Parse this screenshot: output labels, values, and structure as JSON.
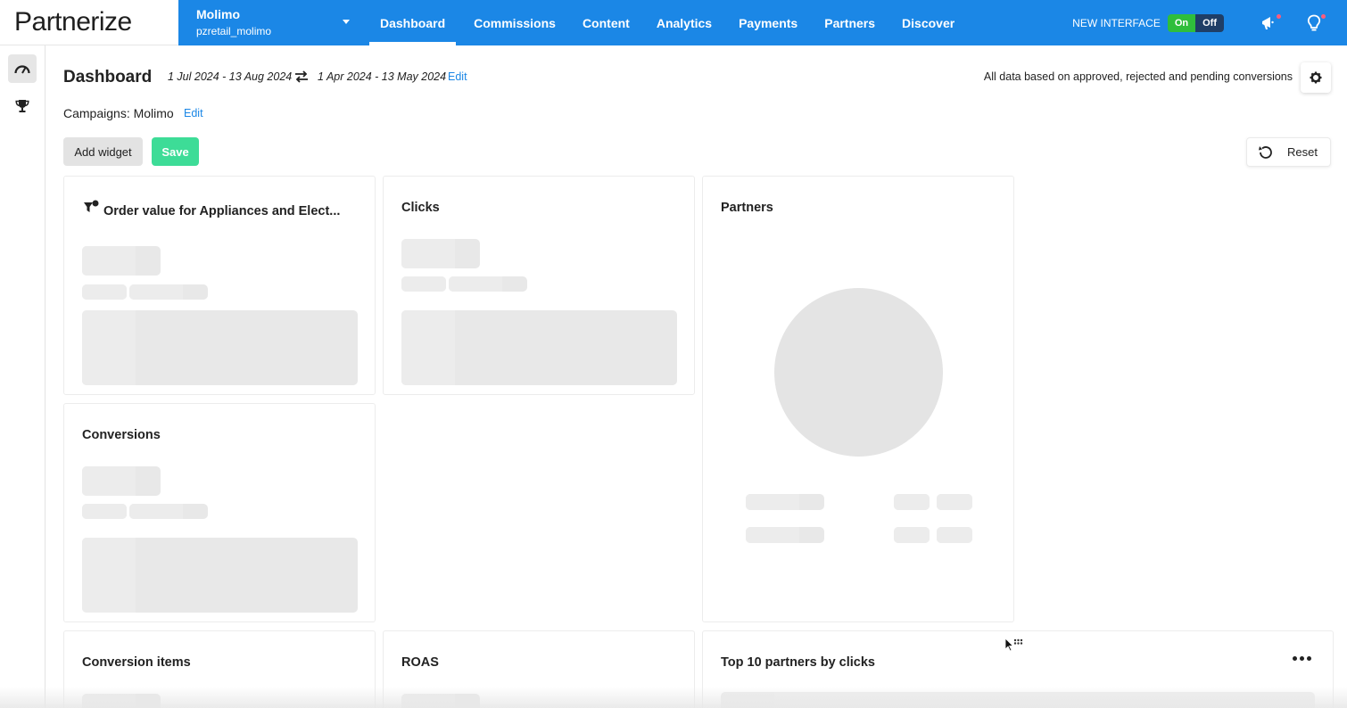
{
  "logo": "Partnerize",
  "account": {
    "name": "Molimo",
    "username": "pzretail_molimo"
  },
  "nav": {
    "tabs": [
      "Dashboard",
      "Commissions",
      "Content",
      "Analytics",
      "Payments",
      "Partners",
      "Discover"
    ],
    "active_tab": "Dashboard",
    "new_interface_label": "NEW INTERFACE",
    "toggle_on": "On",
    "toggle_off": "Off"
  },
  "colors": {
    "nav_bg": "#1b87e6",
    "save_btn": "#3ddc97",
    "toggle_on": "#2fbe3b",
    "toggle_off": "#1f3e66",
    "link": "#1b87e6"
  },
  "header": {
    "title": "Dashboard",
    "date_range": "1 Jul 2024 - 13 Aug 2024",
    "compare_range": "1 Apr 2024 - 13 May 2024",
    "edit": "Edit",
    "data_note": "All data based on approved, rejected and pending conversions",
    "campaigns_label": "Campaigns: Molimo",
    "campaigns_edit": "Edit"
  },
  "toolbar": {
    "add_widget": "Add widget",
    "save": "Save",
    "reset": "Reset"
  },
  "widgets": {
    "order_value": "Order value for Appliances and Elect...",
    "clicks": "Clicks",
    "partners": "Partners",
    "conversions": "Conversions",
    "conversion_items": "Conversion items",
    "roas": "ROAS",
    "top10": "Top 10 partners by clicks"
  },
  "icons": [
    "speedometer-icon",
    "trophy-icon",
    "swap-icon",
    "chevron-down-icon",
    "megaphone-icon",
    "lightbulb-icon",
    "gear-icon",
    "refresh-icon",
    "filter-icon",
    "more-icon",
    "drag-icon"
  ]
}
